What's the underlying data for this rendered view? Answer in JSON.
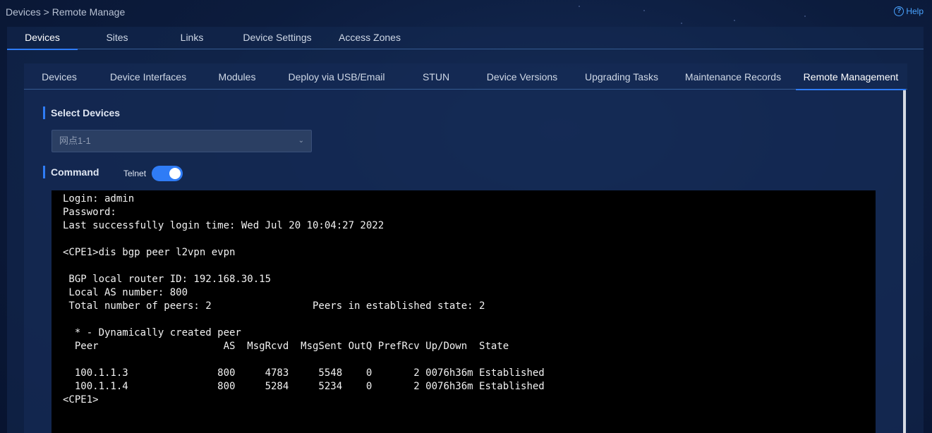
{
  "breadcrumb": "Devices > Remote Manage",
  "help": {
    "label": "Help",
    "icon": "question-circle-icon"
  },
  "top_tabs": [
    {
      "label": "Devices",
      "active": true
    },
    {
      "label": "Sites"
    },
    {
      "label": "Links"
    },
    {
      "label": "Device Settings"
    },
    {
      "label": "Access Zones"
    }
  ],
  "sub_tabs": [
    {
      "label": "Devices"
    },
    {
      "label": "Device Interfaces"
    },
    {
      "label": "Modules"
    },
    {
      "label": "Deploy via USB/Email"
    },
    {
      "label": "STUN"
    },
    {
      "label": "Device Versions"
    },
    {
      "label": "Upgrading Tasks"
    },
    {
      "label": "Maintenance Records"
    },
    {
      "label": "Remote Management",
      "active": true
    }
  ],
  "select_devices": {
    "title": "Select Devices",
    "value": "网点1-1",
    "icon": "chevron-down-icon"
  },
  "command": {
    "title": "Command",
    "telnet_label": "Telnet",
    "telnet_enabled": true
  },
  "terminal": {
    "lines": [
      "Login: admin",
      "Password:",
      "Last successfully login time: Wed Jul 20 10:04:27 2022",
      "",
      "<CPE1>dis bgp peer l2vpn evpn",
      "",
      " BGP local router ID: 192.168.30.15",
      " Local AS number: 800",
      " Total number of peers: 2                 Peers in established state: 2",
      "",
      "  * - Dynamically created peer",
      "  Peer                     AS  MsgRcvd  MsgSent OutQ PrefRcv Up/Down  State",
      "",
      "  100.1.1.3               800     4783     5548    0       2 0076h36m Established",
      "  100.1.1.4               800     5284     5234    0       2 0076h36m Established",
      "<CPE1>"
    ]
  },
  "colors": {
    "accent": "#2f7cf6",
    "background": "#0c1c3d",
    "terminal_bg": "#000000"
  }
}
